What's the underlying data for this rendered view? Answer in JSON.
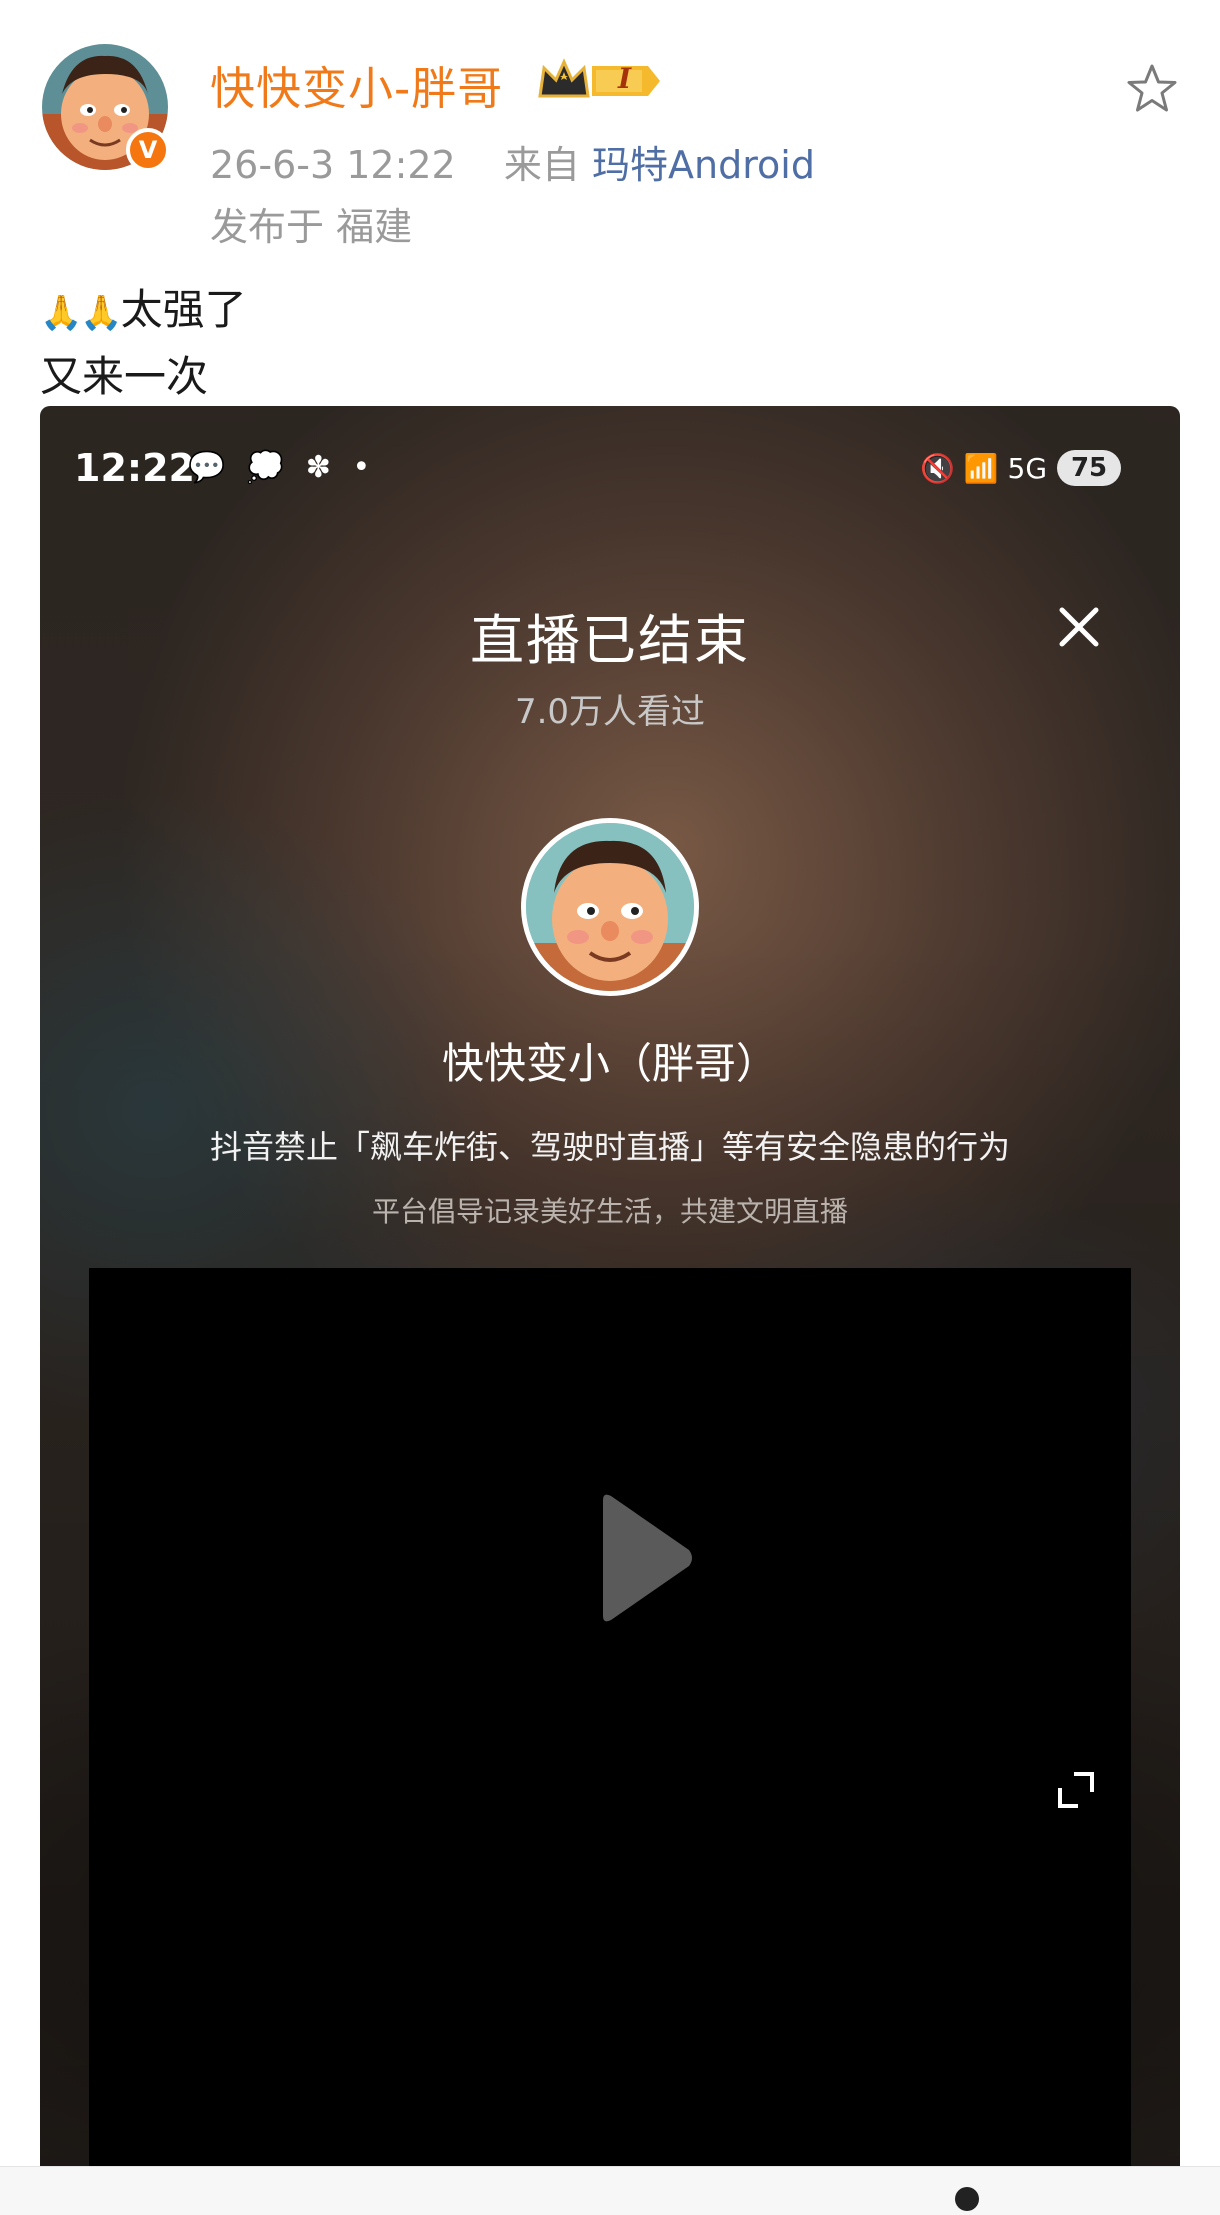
{
  "post": {
    "username": "快快变小-胖哥",
    "vip_badge": "V",
    "crown_level": "I",
    "timestamp": "26-6-3 12:22",
    "from_label": "来自",
    "source": "玛特Android",
    "location": "发布于 福建",
    "text_line1_emoji": "🙏🙏",
    "text_line1": "太强了",
    "text_line2": "又来一次"
  },
  "screenshot": {
    "status_time": "12:22",
    "status_icons_left": "💬 💭 ✽ •",
    "status_icons_right": "🔇 📶 5G",
    "battery": "75",
    "title": "直播已结束",
    "viewers": "7.0万人看过",
    "streamer_name": "快快变小（胖哥）",
    "notice": "抖音禁止「飙车炸街、驾驶时直播」等有安全隐患的行为",
    "sub_notice": "平台倡导记录美好生活，共建文明直播"
  },
  "colors": {
    "username": "#f07a1a",
    "source_link": "#4f6ea5",
    "meta_gray": "#9a9a9a",
    "vip_orange": "#f5750f"
  },
  "icons": {
    "favorite": "star-outline-icon",
    "close": "close-icon",
    "play": "play-icon",
    "fullscreen": "fullscreen-icon"
  }
}
